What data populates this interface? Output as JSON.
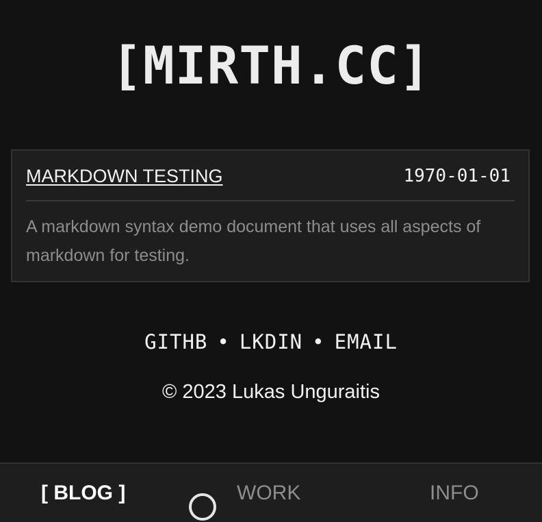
{
  "header": {
    "site_title": "[MIRTH.CC]"
  },
  "posts": [
    {
      "title": "MARKDOWN TESTING",
      "date": "1970-01-01",
      "description": "A markdown syntax demo document that uses all aspects of markdown for testing."
    }
  ],
  "footer": {
    "links": [
      "GITHB",
      "LKDIN",
      "EMAIL"
    ],
    "separator": "•",
    "copyright": "© 2023 Lukas Unguraitis"
  },
  "nav": {
    "items": [
      {
        "label": "[ BLOG ]",
        "active": true
      },
      {
        "label": "WORK",
        "active": false
      },
      {
        "label": "INFO",
        "active": false
      }
    ]
  },
  "colors": {
    "background": "#121212",
    "card": "#1e1e1e",
    "text": "#ececec",
    "muted": "#8d8d8d"
  }
}
